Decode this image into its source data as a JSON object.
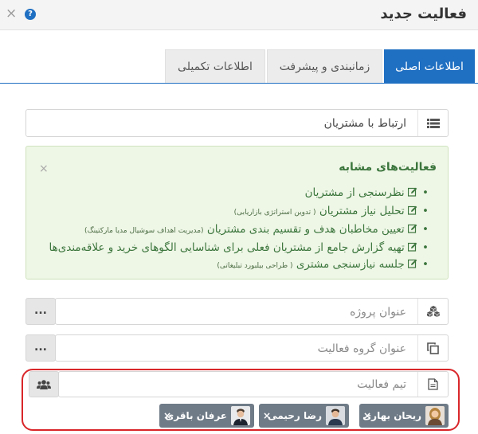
{
  "dialog": {
    "title": "فعالیت جدید",
    "help_glyph": "?",
    "close_glyph": "×"
  },
  "tabs": [
    {
      "label": "اطلاعات اصلی",
      "active": true
    },
    {
      "label": "زمانبندی و پیشرفت",
      "active": false
    },
    {
      "label": "اطلاعات تکمیلی",
      "active": false
    }
  ],
  "fields": {
    "activity_title": {
      "value": "ارتباط با مشتریان",
      "icon": "list-icon"
    },
    "project_title": {
      "placeholder": "عنوان پروژه",
      "icon": "cubes-icon",
      "button_label": "..."
    },
    "group_title": {
      "placeholder": "عنوان گروه فعالیت",
      "icon": "clone-icon",
      "button_label": "..."
    },
    "team": {
      "placeholder": "تیم فعالیت",
      "icon": "file-icon",
      "button_icon": "users-icon"
    }
  },
  "similar": {
    "title": "فعالیت‌های مشابه",
    "close_glyph": "×",
    "items": [
      {
        "text": "نظرسنجی از مشتریان",
        "note": ""
      },
      {
        "text": "تحلیل نیاز مشتریان",
        "note": "( تدوین استراتژی بازاریابی)"
      },
      {
        "text": "تعیین مخاطبان هدف و تقسیم بندی مشتریان",
        "note": "(مدیریت اهداف سوشیال مدیا مارکتینگ)"
      },
      {
        "text": "تهیه گزارش جامع از مشتریان فعلی برای شناسایی الگوهای خرید و علاقه‌مندی‌ها",
        "note": ""
      },
      {
        "text": "جلسه نیازسنجی مشتری",
        "note": "( طراحی بیلبورد تبلیغاتی)"
      }
    ]
  },
  "team_members": [
    {
      "name": "ریحان بهاری",
      "remove": "×"
    },
    {
      "name": "رضا رحیمی",
      "remove": "×"
    },
    {
      "name": "عرفان باقری",
      "remove": "×"
    }
  ],
  "colors": {
    "primary": "#1f6fc2",
    "success_bg": "#eef6e6",
    "success_text": "#3c763d",
    "highlight": "#d9262a",
    "chip": "#6f7b87"
  }
}
